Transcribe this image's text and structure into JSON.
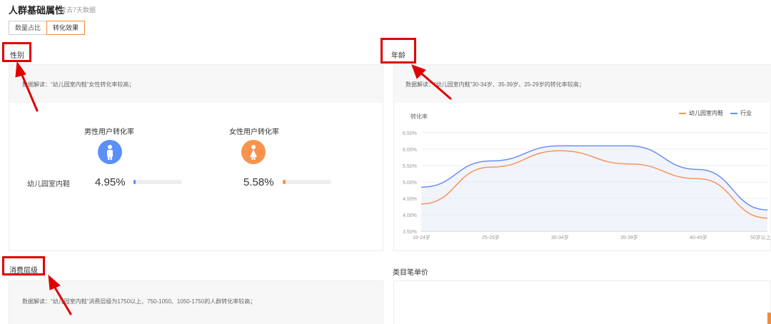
{
  "header": {
    "title": "人群基础属性",
    "subtitle": "过去7天数据"
  },
  "tabs": [
    {
      "label": "数量占比"
    },
    {
      "label": "转化效果"
    }
  ],
  "gender": {
    "title": "性别",
    "insight": "数据解读：“幼儿园室内鞋”女性转化率较高；",
    "male": {
      "title": "男性用户转化率",
      "value": "4.95%",
      "value_num": 4.95,
      "color": "#5b8ff9"
    },
    "female": {
      "title": "女性用户转化率",
      "value": "5.58%",
      "value_num": 5.58,
      "color": "#f7934c"
    },
    "row_label": "幼儿园室内鞋"
  },
  "age": {
    "title": "年龄",
    "insight": "数据解读：“幼儿园室内鞋”30-34岁、35-39岁、25-29岁的转化率较高；",
    "ylabel": "转化率",
    "legend": [
      {
        "name": "幼儿园室内鞋",
        "color": "#f7935a"
      },
      {
        "name": "行业",
        "color": "#6b8ef7"
      }
    ]
  },
  "chart_data": {
    "type": "line",
    "title": "",
    "xlabel": "",
    "ylabel": "转化率",
    "categories": [
      "18-24岁",
      "25-29岁",
      "30-34岁",
      "35-39岁",
      "40-49岁",
      "50岁以上"
    ],
    "ylim": [
      3.5,
      6.5
    ],
    "yticks": [
      "3.50%",
      "4.00%",
      "4.50%",
      "5.00%",
      "5.50%",
      "6.00%",
      "6.50%"
    ],
    "grid": true,
    "legend_position": "top-right",
    "series": [
      {
        "name": "幼儿园室内鞋",
        "values": [
          4.33,
          5.45,
          5.95,
          5.55,
          5.1,
          3.9
        ]
      },
      {
        "name": "行业",
        "values": [
          4.84,
          5.64,
          6.1,
          6.1,
          5.38,
          4.15
        ]
      }
    ]
  },
  "consumption": {
    "title": "消费层级",
    "insight": "数据解读：“幼儿园室内鞋”消费层级为1750以上、750-1050、1050-1750的人群转化率较高；"
  },
  "unit_price": {
    "title": "类目笔单价"
  }
}
